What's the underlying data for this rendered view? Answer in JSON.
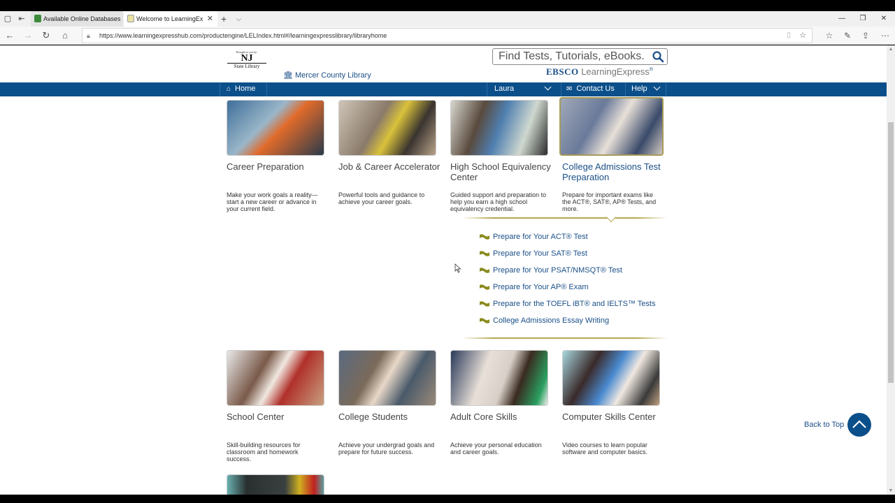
{
  "browser": {
    "tabs": [
      {
        "label": "Available Online Databases",
        "active": false
      },
      {
        "label": "Welcome to LearningEx",
        "active": true
      }
    ],
    "url": "https://www.learningexpresshub.com/productengine/LELIndex.html#/learningexpresslibrary/libraryhome"
  },
  "header": {
    "brought_by": "Brought to you by:",
    "nj_logo": "NJ",
    "nj_logo_sub": "State Library",
    "library_name": "Mercer County Library",
    "search_placeholder": "Find Tests, Tutorials, eBooks.",
    "ebsco_brand": "EBSCO",
    "ebsco_product": "LearningExpress",
    "ebsco_reg": "®"
  },
  "nav": {
    "home": "Home",
    "user": "Laura",
    "contact": "Contact Us",
    "help": "Help"
  },
  "cards_row1": [
    {
      "title": "Career Preparation",
      "desc": "Make your work goals a reality—start a new career or advance in your current field."
    },
    {
      "title": "Job & Career Accelerator",
      "desc": "Powerful tools and guidance to achieve your career goals."
    },
    {
      "title": "High School Equivalency Center",
      "desc": "Guided support and preparation to help you earn a high school equivalency credential."
    },
    {
      "title": "College Admissions Test Preparation",
      "desc": "Prepare for important exams like the ACT®, SAT®, AP® Tests, and more."
    }
  ],
  "submenu": [
    "Prepare for Your ACT® Test",
    "Prepare for Your SAT® Test",
    "Prepare for Your PSAT/NMSQT® Test",
    "Prepare for Your AP® Exam",
    "Prepare for the TOEFL iBT® and IELTS™ Tests",
    "College Admissions Essay Writing"
  ],
  "cards_row2": [
    {
      "title": "School Center",
      "desc": "Skill-building resources for classroom and homework success."
    },
    {
      "title": "College Students",
      "desc": "Achieve your undergrad goals and prepare for future success."
    },
    {
      "title": "Adult Core Skills",
      "desc": "Achieve your personal education and career goals."
    },
    {
      "title": "Computer Skills Center",
      "desc": "Video courses to learn popular software and computer basics."
    }
  ],
  "back_to_top": "Back to Top",
  "colors": {
    "brand_blue": "#0b4f8a",
    "gold": "#b6a84e",
    "link_blue": "#1a4f87"
  }
}
